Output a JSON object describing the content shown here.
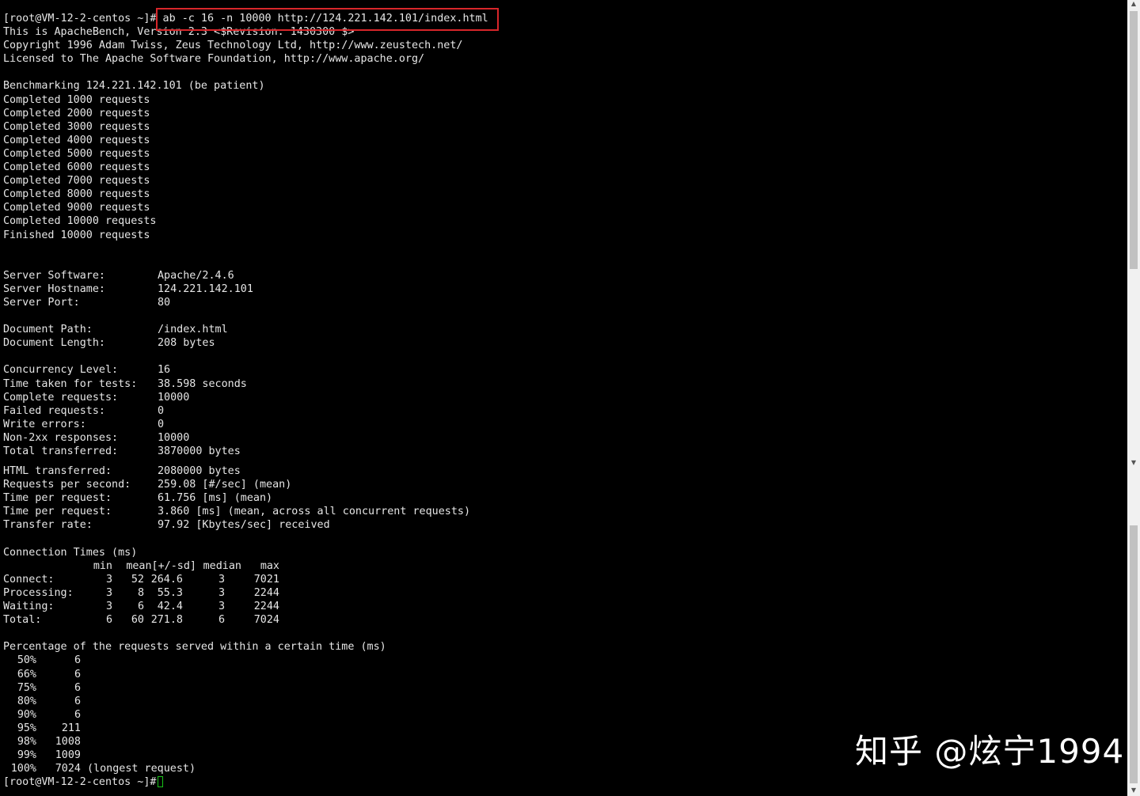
{
  "prompt": "[root@VM-12-2-centos ~]#",
  "command": "ab -c 16 -n 10000 http://124.221.142.101/index.html",
  "header_lines": [
    "This is ApacheBench, Version 2.3 <$Revision: 1430300 $>",
    "Copyright 1996 Adam Twiss, Zeus Technology Ltd, http://www.zeustech.net/",
    "Licensed to The Apache Software Foundation, http://www.apache.org/"
  ],
  "benchmark_line": "Benchmarking 124.221.142.101 (be patient)",
  "progress_lines": [
    "Completed 1000 requests",
    "Completed 2000 requests",
    "Completed 3000 requests",
    "Completed 4000 requests",
    "Completed 5000 requests",
    "Completed 6000 requests",
    "Completed 7000 requests",
    "Completed 8000 requests",
    "Completed 9000 requests",
    "Completed 10000 requests",
    "Finished 10000 requests"
  ],
  "server": [
    {
      "label": "Server Software:",
      "value": "Apache/2.4.6"
    },
    {
      "label": "Server Hostname:",
      "value": "124.221.142.101"
    },
    {
      "label": "Server Port:",
      "value": "80"
    }
  ],
  "document": [
    {
      "label": "Document Path:",
      "value": "/index.html"
    },
    {
      "label": "Document Length:",
      "value": "208 bytes"
    }
  ],
  "stats_a": [
    {
      "label": "Concurrency Level:",
      "value": "16"
    },
    {
      "label": "Time taken for tests:",
      "value": "38.598 seconds"
    },
    {
      "label": "Complete requests:",
      "value": "10000"
    },
    {
      "label": "Failed requests:",
      "value": "0"
    },
    {
      "label": "Write errors:",
      "value": "0"
    },
    {
      "label": "Non-2xx responses:",
      "value": "10000"
    },
    {
      "label": "Total transferred:",
      "value": "3870000 bytes"
    }
  ],
  "stats_b": [
    {
      "label": "HTML transferred:",
      "value": "2080000 bytes"
    },
    {
      "label": "Requests per second:",
      "value": "259.08 [#/sec] (mean)"
    },
    {
      "label": "Time per request:",
      "value": "61.756 [ms] (mean)"
    },
    {
      "label": "Time per request:",
      "value": "3.860 [ms] (mean, across all concurrent requests)"
    },
    {
      "label": "Transfer rate:",
      "value": "97.92 [Kbytes/sec] received"
    }
  ],
  "connection_times": {
    "title": "Connection Times (ms)",
    "headers": [
      "min",
      "mean[+/-sd]",
      "median",
      "max"
    ],
    "rows": [
      {
        "label": "Connect:",
        "min": "3",
        "mean": "52",
        "sd": "264.6",
        "median": "3",
        "max": "7021"
      },
      {
        "label": "Processing:",
        "min": "3",
        "mean": "8",
        "sd": "55.3",
        "median": "3",
        "max": "2244"
      },
      {
        "label": "Waiting:",
        "min": "3",
        "mean": "6",
        "sd": "42.4",
        "median": "3",
        "max": "2244"
      },
      {
        "label": "Total:",
        "min": "6",
        "mean": "60",
        "sd": "271.8",
        "median": "6",
        "max": "7024"
      }
    ]
  },
  "percentage": {
    "title": "Percentage of the requests served within a certain time (ms)",
    "rows": [
      {
        "pct": "50%",
        "value": "6",
        "note": ""
      },
      {
        "pct": "66%",
        "value": "6",
        "note": ""
      },
      {
        "pct": "75%",
        "value": "6",
        "note": ""
      },
      {
        "pct": "80%",
        "value": "6",
        "note": ""
      },
      {
        "pct": "90%",
        "value": "6",
        "note": ""
      },
      {
        "pct": "95%",
        "value": "211",
        "note": ""
      },
      {
        "pct": "98%",
        "value": "1008",
        "note": ""
      },
      {
        "pct": "99%",
        "value": "1009",
        "note": ""
      },
      {
        "pct": "100%",
        "value": "7024",
        "note": "(longest request)"
      }
    ]
  },
  "watermark": "知乎 @炫宁1994",
  "colors": {
    "background": "#000000",
    "text": "#e6e6e6",
    "highlight_border": "#d8262a",
    "cursor": "#18c218"
  }
}
